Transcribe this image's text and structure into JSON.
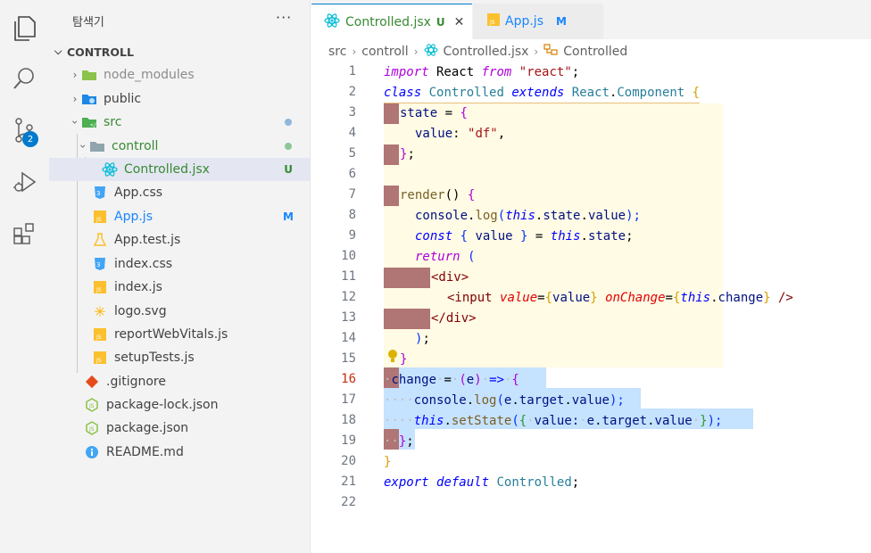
{
  "sidebar": {
    "title": "탐색기",
    "more": "···",
    "section": "CONTROLL",
    "items": [
      {
        "label": "node_modules",
        "decoration": ""
      },
      {
        "label": "public",
        "decoration": ""
      },
      {
        "label": "src",
        "decoration": ""
      },
      {
        "label": "controll",
        "decoration": ""
      },
      {
        "label": "Controlled.jsx",
        "decoration": "U"
      },
      {
        "label": "App.css",
        "decoration": ""
      },
      {
        "label": "App.js",
        "decoration": "M"
      },
      {
        "label": "App.test.js",
        "decoration": ""
      },
      {
        "label": "index.css",
        "decoration": ""
      },
      {
        "label": "index.js",
        "decoration": ""
      },
      {
        "label": "logo.svg",
        "decoration": ""
      },
      {
        "label": "reportWebVitals.js",
        "decoration": ""
      },
      {
        "label": "setupTests.js",
        "decoration": ""
      },
      {
        "label": ".gitignore",
        "decoration": ""
      },
      {
        "label": "package-lock.json",
        "decoration": ""
      },
      {
        "label": "package.json",
        "decoration": ""
      },
      {
        "label": "README.md",
        "decoration": ""
      }
    ]
  },
  "activity": {
    "source_control_badge": "2"
  },
  "tabs": [
    {
      "label": "Controlled.jsx",
      "decoration": "U",
      "close": "✕"
    },
    {
      "label": "App.js",
      "decoration": "M"
    }
  ],
  "breadcrumb": {
    "parts": [
      "src",
      "controll",
      "Controlled.jsx",
      "Controlled"
    ]
  },
  "editor": {
    "line_numbers": [
      "1",
      "2",
      "3",
      "4",
      "5",
      "6",
      "7",
      "8",
      "9",
      "10",
      "11",
      "12",
      "13",
      "14",
      "15",
      "16",
      "17",
      "18",
      "19",
      "20",
      "21",
      "22"
    ],
    "tokens": {
      "l1": [
        "import",
        " React ",
        "from",
        " ",
        "\"react\"",
        ";"
      ],
      "l2": [
        "class",
        " ",
        "Controlled",
        " ",
        "extends",
        " ",
        "React",
        ".",
        "Component",
        " ",
        "{"
      ],
      "l3": [
        "state",
        " = ",
        "{"
      ],
      "l4": [
        "value",
        ": ",
        "\"df\"",
        ","
      ],
      "l5": [
        "}",
        ";"
      ],
      "l7": [
        "render",
        "() ",
        "{"
      ],
      "l8": [
        "console",
        ".",
        "log",
        "(",
        "this",
        ".",
        "state",
        ".",
        "value",
        ");"
      ],
      "l9": [
        "const",
        " ",
        "{",
        " value ",
        "}",
        " = ",
        "this",
        ".",
        "state",
        ";"
      ],
      "l10": [
        "return",
        " ",
        "("
      ],
      "l11": [
        "<div>"
      ],
      "l12": [
        "<input",
        " ",
        "value",
        "=",
        "{",
        "value",
        "}",
        " ",
        "onChange",
        "=",
        "{",
        "this",
        ".",
        "change",
        "}",
        " ",
        "/>"
      ],
      "l13": [
        "</div>"
      ],
      "l14": [
        ")",
        ";"
      ],
      "l15": [
        "}"
      ],
      "l16": [
        "·",
        "change",
        "·",
        "=",
        "·",
        "(",
        "e",
        ")",
        "·",
        "=>",
        "·",
        "{"
      ],
      "l17": [
        "····",
        "console",
        ".",
        "log",
        "(",
        "e",
        ".",
        "target",
        ".",
        "value",
        ");"
      ],
      "l18": [
        "····",
        "this",
        ".",
        "setState",
        "(",
        "{",
        "·",
        "value:",
        "·",
        "e",
        ".",
        "target",
        ".",
        "value",
        "·",
        "}",
        ");"
      ],
      "l19": [
        "··",
        "}",
        ";"
      ],
      "l20": [
        "}"
      ],
      "l21": [
        "export",
        " ",
        "default",
        " ",
        "Controlled",
        ";"
      ]
    }
  },
  "colors": {
    "accent": "#007acc",
    "untracked": "#73c991",
    "modified": "#1a85ff",
    "selection": "#add6ff"
  }
}
